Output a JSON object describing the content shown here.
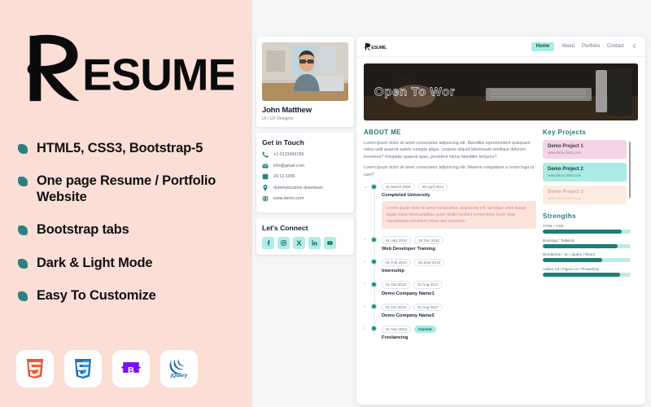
{
  "promo": {
    "logo_text": "RESUME.",
    "features": [
      {
        "text": "HTML5, CSS3, Bootstrap-5"
      },
      {
        "text": "One page Resume / Portfolio Website"
      },
      {
        "text": "Bootstrap tabs"
      },
      {
        "text": "Dark & Light Mode"
      },
      {
        "text": "Easy To Customize"
      }
    ],
    "tech_badges": [
      {
        "name": "html5-icon",
        "label": "HTML5"
      },
      {
        "name": "css3-icon",
        "label": "CSS3"
      },
      {
        "name": "bootstrap-icon",
        "label": "Bootstrap"
      },
      {
        "name": "jquery-icon",
        "label": "jQuery"
      }
    ],
    "colors": {
      "background": "#fbded6",
      "bullet": "#2d8080",
      "text": "#111111"
    }
  },
  "preview": {
    "profile": {
      "name": "John Matthew",
      "role": "UI / UX Designer",
      "photo_alt": "profile-photo"
    },
    "contact": {
      "title": "Get in Touch",
      "items": [
        {
          "icon": "phone-icon",
          "value": "+1-0123456789"
        },
        {
          "icon": "mail-icon",
          "value": "info@gmail.com"
        },
        {
          "icon": "calendar-icon",
          "value": "24.12.1996"
        },
        {
          "icon": "location-icon",
          "value": "dummylocation downtown"
        },
        {
          "icon": "globe-icon",
          "value": "www.demo.com"
        }
      ]
    },
    "connect": {
      "title": "Let's Connect",
      "socials": [
        {
          "icon": "facebook-icon",
          "label": "f"
        },
        {
          "icon": "instagram-icon",
          "label": "o"
        },
        {
          "icon": "x-twitter-icon",
          "label": "X"
        },
        {
          "icon": "linkedin-icon",
          "label": "in"
        },
        {
          "icon": "youtube-icon",
          "label": "yt"
        }
      ]
    },
    "navbar": {
      "logo_text": "RESUME.",
      "links": [
        {
          "label": "Home",
          "active": true
        },
        {
          "label": "About",
          "active": false
        },
        {
          "label": "Portfolio",
          "active": false
        },
        {
          "label": "Contact",
          "active": false
        }
      ],
      "theme_toggle_icon": "moon-icon",
      "theme_toggle_glyph": "☾",
      "active_color": "#a8ece3"
    },
    "hero": {
      "headline": "Open To Wor"
    },
    "about": {
      "title": "ABOUT ME",
      "paragraphs": [
        "Lorem ipsum dolor sit amet consectetur adipisicing elit. Blanditiis reprehenderit quisquam natus velit quaerat autem cumque atque, corporis aliquid laboriosam similique dolorem inventore? Voluptate quaerat quas, provident minus blanditiis tempore?",
        "Lorem ipsum dolor sit amet consectetur adipisicing elit. Maxime voluptatum a rerum fuga ut cum?"
      ]
    },
    "timeline": [
      {
        "start": "31 March 2009",
        "end": "25 April 2012",
        "title": "Completed University",
        "expanded": true,
        "body": "Lorem ipsum dolor sit amet consectetur, adipisicing elit. Similique enim itaque fugiat natus necessitatibus quam facilis incidunt consectetur. Esse vitae repudiandae provident minus quo inventore."
      },
      {
        "start": "01 July 2012",
        "end": "25 Dec 2012",
        "title": "Web Developer Training",
        "expanded": false,
        "body": ""
      },
      {
        "start": "01 Feb 2013",
        "end": "26 Sept 2013",
        "title": "Internship",
        "expanded": false,
        "body": ""
      },
      {
        "start": "01 Oct 2013",
        "end": "31 Aug 2017",
        "title": "Demo Company Name1",
        "expanded": false,
        "body": ""
      },
      {
        "start": "01 Oct 2013",
        "end": "31 Aug 2017",
        "title": "Demo Company Name2",
        "expanded": false,
        "body": ""
      },
      {
        "start": "01 Nov 2023",
        "end": "Current",
        "title": "Freelancing",
        "expanded": false,
        "body": "",
        "end_is_badge": true
      }
    ],
    "projects": {
      "title": "Key Projects",
      "items": [
        {
          "name": "Demo Project 1",
          "link": "www.demo.link1.com",
          "bg": "#f6d2e6",
          "name_color": "#3b3b4d",
          "link_color": "#8a7f8d"
        },
        {
          "name": "Demo Project 2",
          "link": "www.demo.link2.com",
          "bg": "#a8ece3",
          "name_color": "#25333a",
          "link_color": "#5c7f7c"
        },
        {
          "name": "Demo Project 3",
          "link": "www.demo.link3.com",
          "bg": "#fdece2",
          "name_color": "#e0a893",
          "link_color": "#e8bfae"
        }
      ]
    },
    "strengths": {
      "title": "Strengths",
      "items": [
        {
          "label": "HTML / CSS",
          "percent": 90
        },
        {
          "label": "Bootstap / Tailwind",
          "percent": 85
        },
        {
          "label": "Wordpress / Js / Jquery / React",
          "percent": 68
        },
        {
          "label": "Adobe Xd / Figma /Ai / Photoshop",
          "percent": 88
        }
      ],
      "track_color": "#b6eee7",
      "fill_color": "#1d7d78"
    }
  }
}
